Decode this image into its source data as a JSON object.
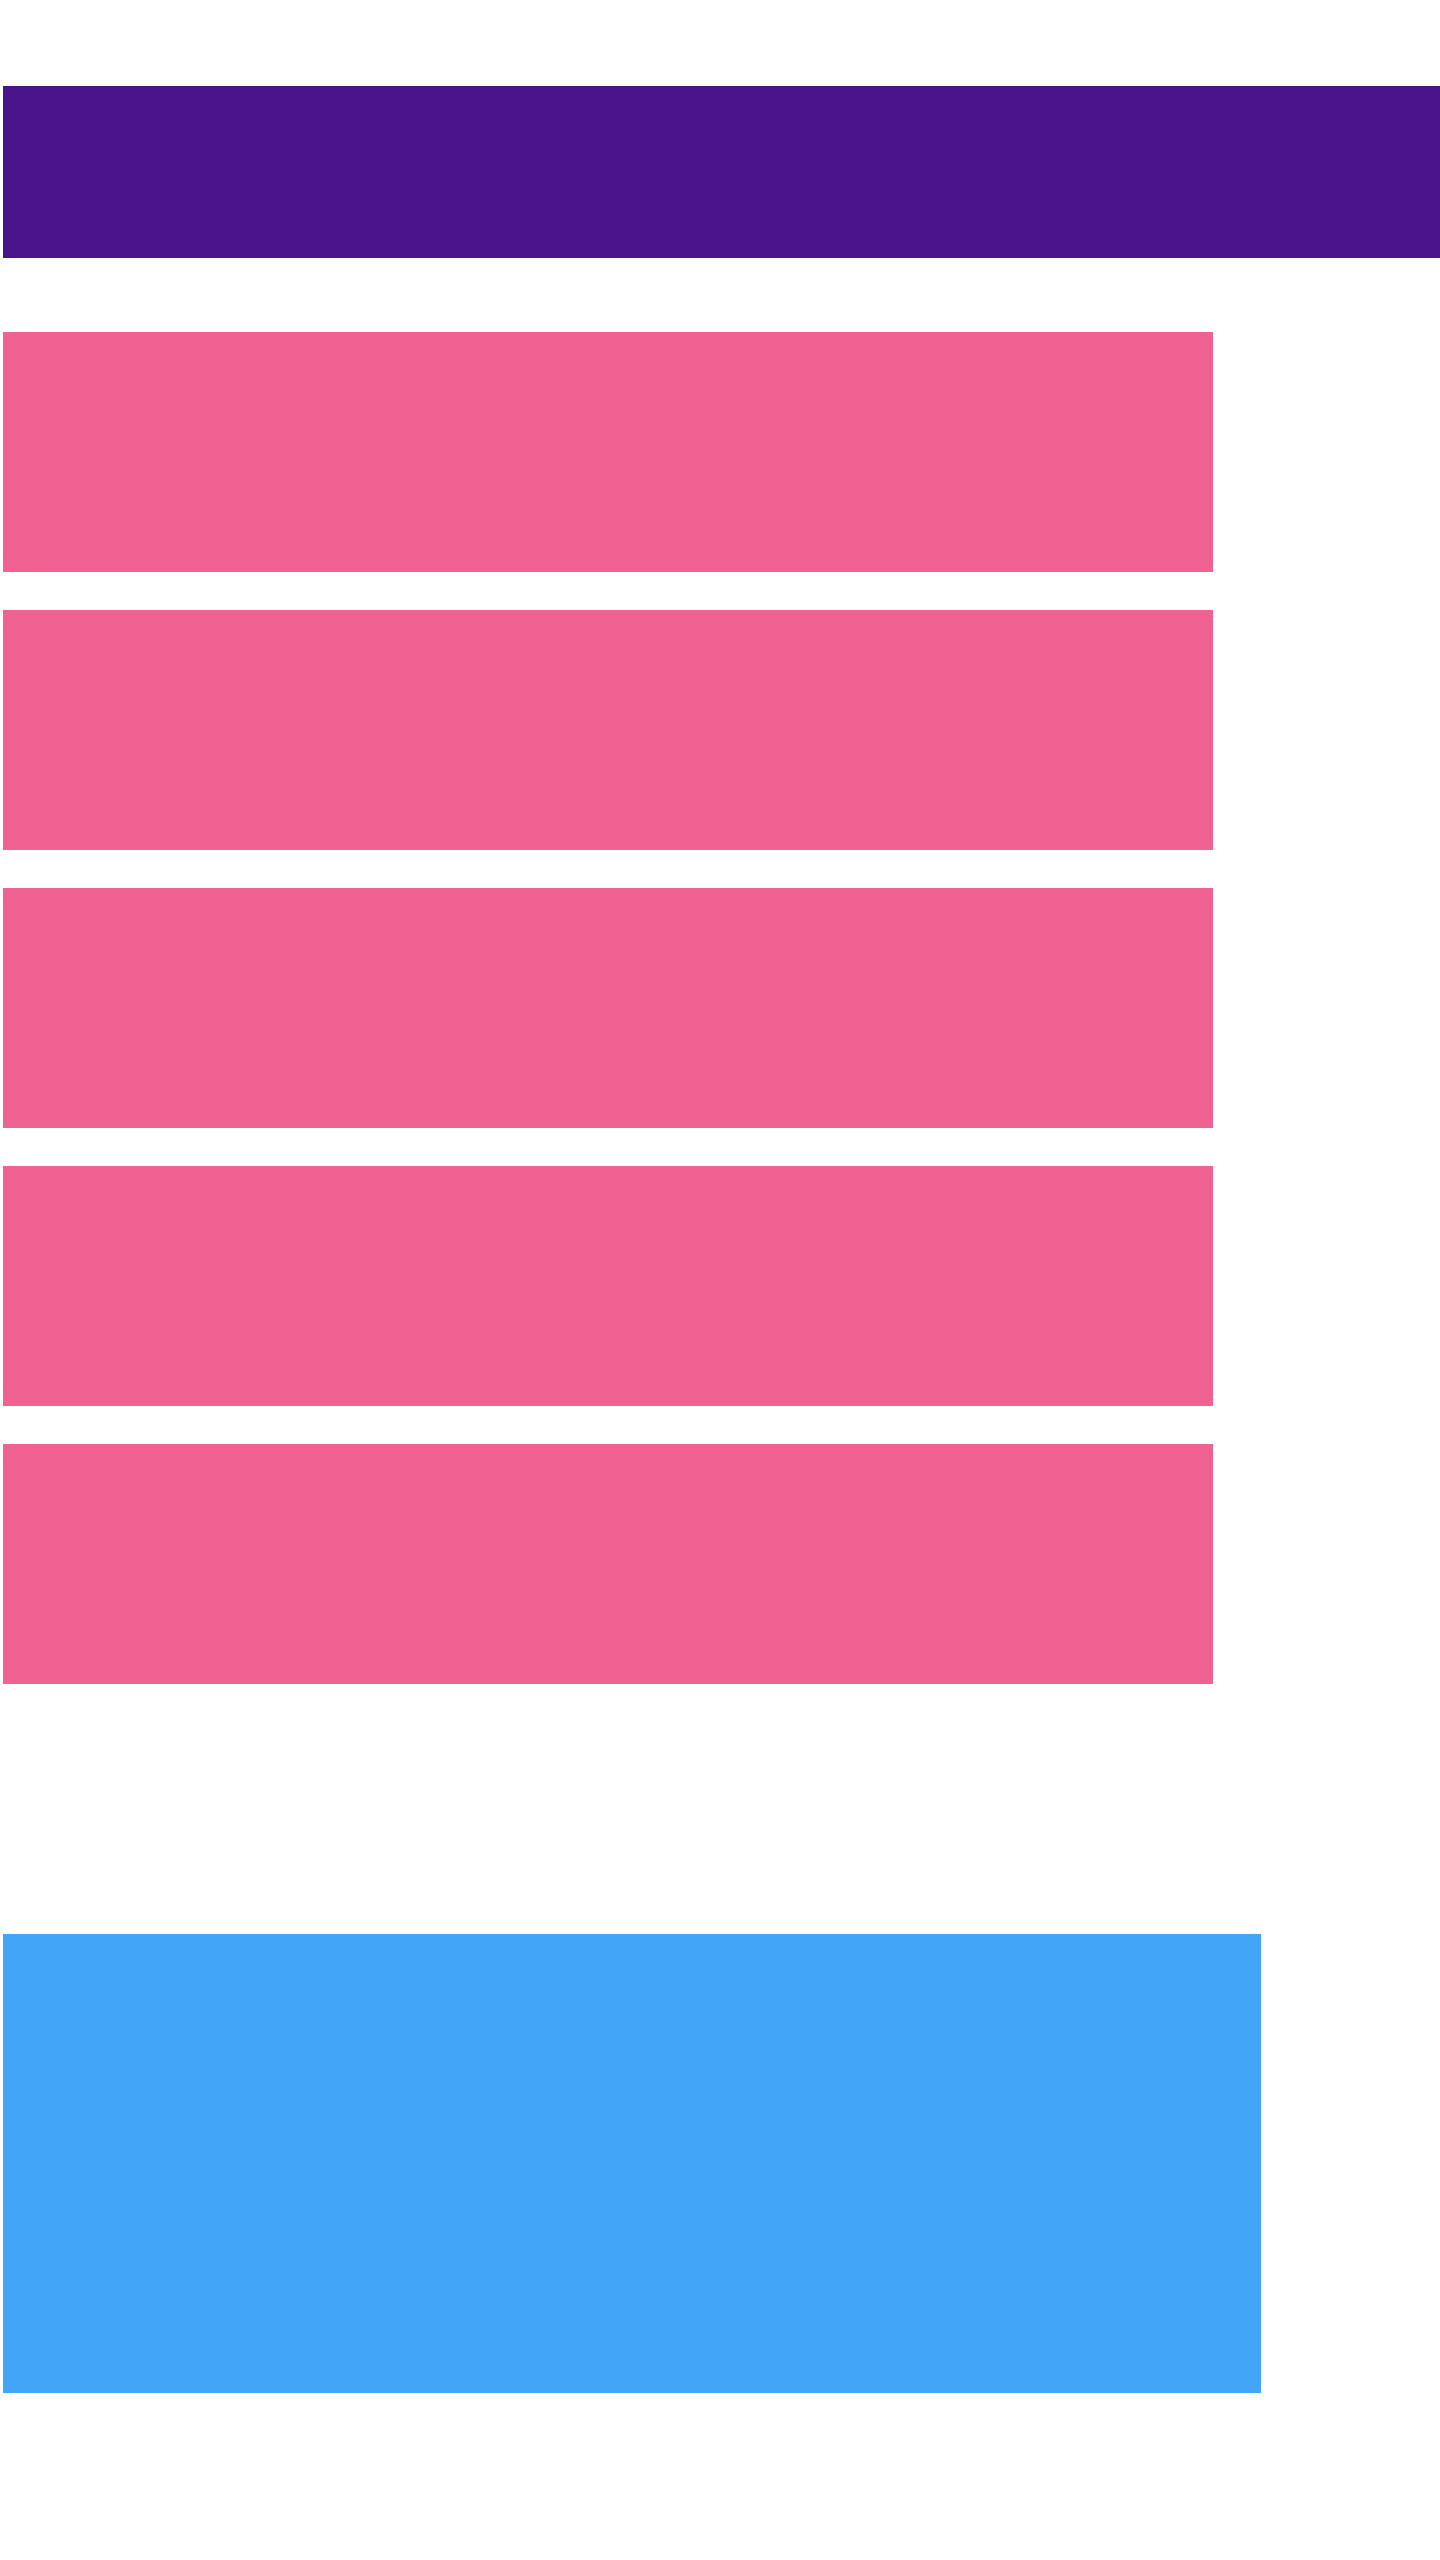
{
  "colors": {
    "header": "#4a148c",
    "card": "#f06292",
    "panel": "#42a5f5",
    "background": "#ffffff"
  },
  "cards": [
    "",
    "",
    "",
    "",
    ""
  ]
}
